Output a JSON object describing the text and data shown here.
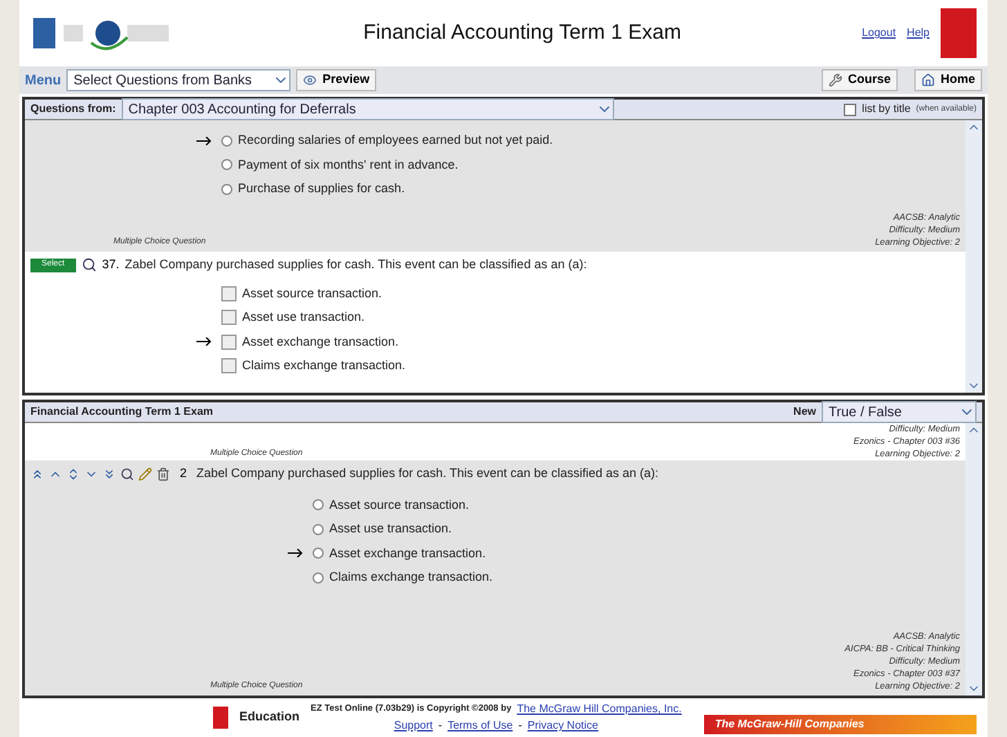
{
  "header": {
    "title": "Financial Accounting Term 1 Exam",
    "links": [
      "Logout",
      "Help"
    ]
  },
  "toolbar": {
    "menu_label": "Menu",
    "menu_select": "Select Questions from Banks",
    "preview": "Preview",
    "course": "Course",
    "home": "Home"
  },
  "bank_panel": {
    "label": "Questions from:",
    "chapter": "Chapter 003 Accounting for Deferrals",
    "list_by_title": {
      "label": "list by title",
      "hint": "(when available)",
      "checked": false
    },
    "questions": [
      {
        "kind": "radio",
        "shaded": true,
        "options": [
          {
            "text": "Recording salaries of employees earned but not yet paid.",
            "correct": true,
            "checked": false
          },
          {
            "text": "Payment of six months' rent in advance.",
            "correct": false,
            "checked": false
          },
          {
            "text": "Purchase of supplies for cash.",
            "correct": false,
            "checked": false
          }
        ],
        "meta": [
          "AACSB: Analytic",
          "Difficulty: Medium",
          "Learning Objective: 2"
        ],
        "type_label": "Multiple Choice Question"
      },
      {
        "kind": "checkbox",
        "shaded": false,
        "number": "37.",
        "text": "Zabel Company purchased supplies for cash. This event can be classified as an (a):",
        "select_label": "Select",
        "options": [
          {
            "text": "Asset source transaction.",
            "correct": false,
            "checked": false
          },
          {
            "text": "Asset use transaction.",
            "correct": false,
            "checked": false
          },
          {
            "text": "Asset exchange transaction.",
            "correct": true,
            "checked": false
          },
          {
            "text": "Claims exchange transaction.",
            "correct": false,
            "checked": false
          }
        ]
      }
    ]
  },
  "exam_panel": {
    "heading": "Financial Accounting Term 1 Exam",
    "new_label": "New",
    "new_type": "True / False",
    "top_meta": [
      "Difficulty: Medium",
      "Ezonics - Chapter 003 #36",
      "Learning Objective: 2"
    ],
    "top_type_label": "Multiple Choice Question",
    "question": {
      "number": "2",
      "text": "Zabel Company purchased supplies for cash. This event can be classified as an (a):",
      "options": [
        {
          "text": "Asset source transaction.",
          "correct": false,
          "checked": false
        },
        {
          "text": "Asset use transaction.",
          "correct": false,
          "checked": false
        },
        {
          "text": "Asset exchange transaction.",
          "correct": true,
          "checked": false
        },
        {
          "text": "Claims exchange transaction.",
          "correct": false,
          "checked": false
        }
      ],
      "meta": [
        "AACSB: Analytic",
        "AICPA: BB - Critical Thinking",
        "Difficulty: Medium",
        "Ezonics - Chapter 003 #37",
        "Learning Objective: 2"
      ],
      "type_label": "Multiple Choice Question"
    }
  },
  "footer": {
    "copyright": "EZ Test Online (7.03b29) is Copyright ©2008 by",
    "company_link": "The McGraw Hill Companies, Inc.",
    "links": [
      "Support",
      "Terms of Use",
      "Privacy Notice"
    ],
    "separator": "-",
    "education": "Education",
    "banner": "The McGraw-Hill Companies"
  }
}
